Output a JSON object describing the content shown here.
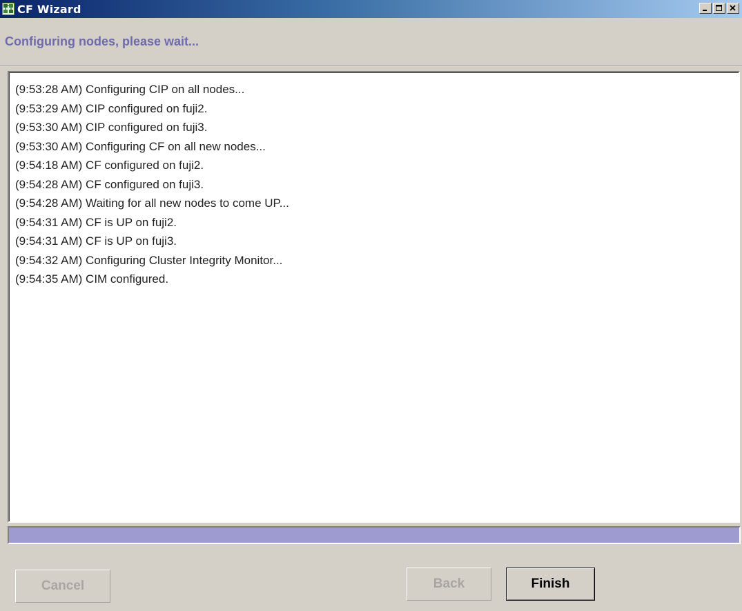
{
  "window": {
    "title": "CF Wizard",
    "icon": "cf-wizard-app-icon",
    "controls": [
      "minimize-icon",
      "maximize-icon",
      "close-icon"
    ]
  },
  "header": {
    "status": "Configuring nodes, please wait..."
  },
  "log": {
    "lines": [
      "(9:53:28 AM) Configuring CIP on all nodes...",
      "(9:53:29 AM) CIP configured on fuji2.",
      "(9:53:30 AM) CIP configured on fuji3.",
      "(9:53:30 AM) Configuring CF on all new nodes...",
      "(9:54:18 AM) CF configured on fuji2.",
      "(9:54:28 AM) CF configured on fuji3.",
      "(9:54:28 AM) Waiting for all new nodes to come UP...",
      "(9:54:31 AM) CF is UP on fuji2.",
      "(9:54:31 AM) CF is UP on fuji3.",
      "(9:54:32 AM) Configuring Cluster Integrity Monitor...",
      "(9:54:35 AM) CIM configured."
    ]
  },
  "progress": {
    "fraction": 1.0,
    "color": "#9d9bcf"
  },
  "buttons": {
    "cancel": {
      "label": "Cancel",
      "enabled": false
    },
    "back": {
      "label": "Back",
      "enabled": false
    },
    "finish": {
      "label": "Finish",
      "enabled": true
    }
  },
  "colors": {
    "status_text": "#6f6bab",
    "window_bg": "#d4d0c8",
    "titlebar_start": "#0a246a",
    "titlebar_end": "#a6caf0"
  }
}
